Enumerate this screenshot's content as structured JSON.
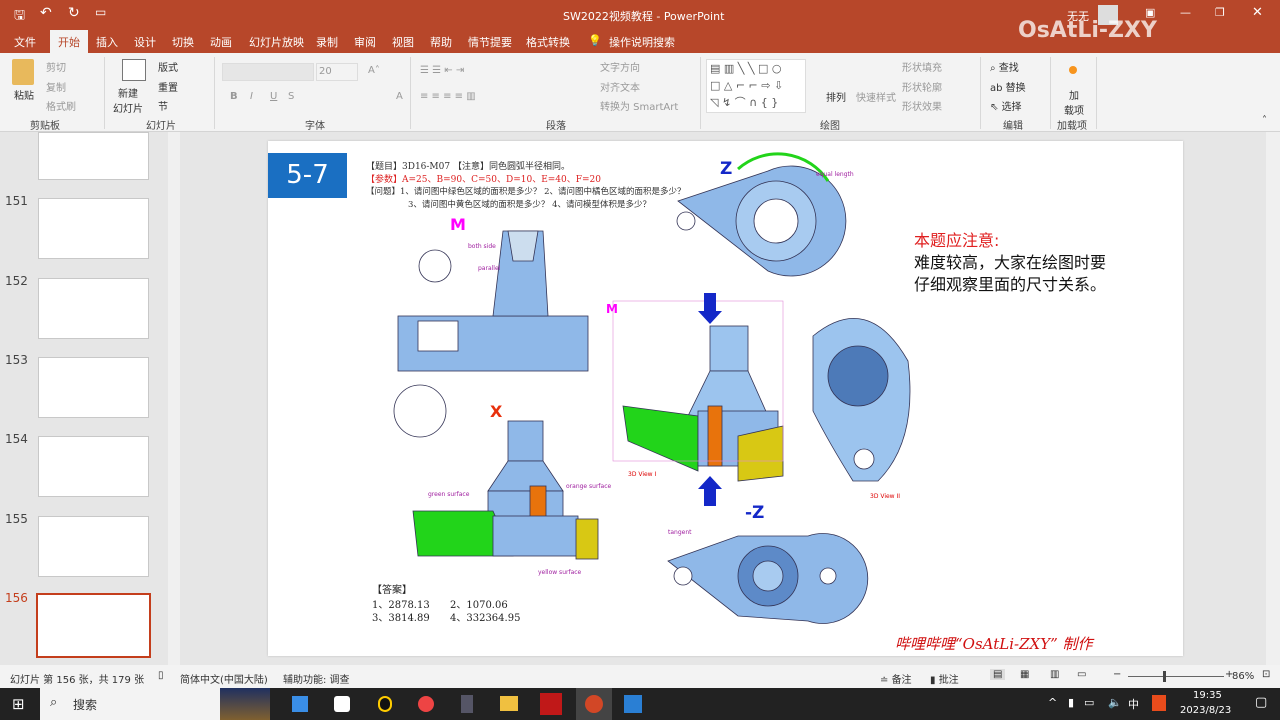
{
  "title": {
    "doc": "SW2022视频教程  -  PowerPoint",
    "user": "无无",
    "watermark": "OsAtLi-ZXY"
  },
  "tabs": [
    "文件",
    "开始",
    "插入",
    "设计",
    "切换",
    "动画",
    "幻灯片放映",
    "录制",
    "审阅",
    "视图",
    "帮助",
    "情节提要",
    "格式转换",
    "操作说明搜索"
  ],
  "ribbon": {
    "clipboard": {
      "paste": "粘贴",
      "cut": "剪切",
      "copy": "复制",
      "format_painter": "格式刷",
      "label": "剪贴板"
    },
    "slides": {
      "new": "新建\n幻灯片",
      "layout": "版式",
      "reset": "重置",
      "section": "节",
      "label": "幻灯片"
    },
    "font": {
      "size": "20",
      "label": "字体"
    },
    "paragraph": {
      "text_dir": "文字方向",
      "align_text": "对齐文本",
      "smartart": "转换为 SmartArt",
      "label": "段落"
    },
    "drawing": {
      "arrange": "排列",
      "quick_styles": "快速样式",
      "fill": "形状填充",
      "outline": "形状轮廓",
      "effects": "形状效果",
      "label": "绘图"
    },
    "editing": {
      "find": "查找",
      "replace": "替换",
      "select": "选择",
      "label": "编辑"
    },
    "addins": {
      "btn": "加\n载项",
      "label": "加载项"
    }
  },
  "thumbs": {
    "numbers": [
      "151",
      "152",
      "153",
      "154",
      "155",
      "156"
    ]
  },
  "slide": {
    "badge": "5-7",
    "line1": "【题目】3D16-M07    【注意】同色圆弧半径相同。",
    "line2": "【参数】A=25、B=90、C=50、D=10、E=40、F=20",
    "line3": "【问题】1、请问图中绿色区域的面积是多少？ 2、请问图中橘色区域的面积是多少？",
    "line4": "3、请问图中黄色区域的面积是多少？ 4、请问模型体积是多少？",
    "labels": {
      "m": "M",
      "x": "X",
      "z": "Z",
      "negz": "-Z",
      "view1": "3D View I",
      "view2": "3D View II",
      "green": "green surface",
      "orange": "orange surface",
      "yellow": "yellow surface",
      "tangent": "tangent",
      "equal": "equal length",
      "parallel": "parallel",
      "both": "both side"
    },
    "answers_title": "【答案】",
    "answers": [
      "1、2878.13",
      "2、1070.06",
      "3、3814.89",
      "4、332364.95"
    ],
    "note_title": "本题应注意:",
    "note_lines": [
      "难度较高，大家在绘图时要",
      "仔细观察里面的尺寸关系。"
    ],
    "credit": "哔哩哔哩“OsAtLi-ZXY” 制作"
  },
  "status": {
    "slide": "幻灯片 第 156 张，共 179 张",
    "lang": "简体中文(中国大陆)",
    "access": "辅助功能: 调查",
    "notes": "备注",
    "comments": "批注",
    "zoom": "86%"
  },
  "taskbar": {
    "search": "搜索",
    "time": "19:35",
    "date": "2023/8/23",
    "ime": "中"
  },
  "colors": {
    "accent": "#b7472a",
    "badge": "#1a6fc2",
    "note_red": "#e02020",
    "green": "#22d41a",
    "orange": "#e8730c",
    "yellow": "#d8c814",
    "part": "#7fb2e6"
  }
}
